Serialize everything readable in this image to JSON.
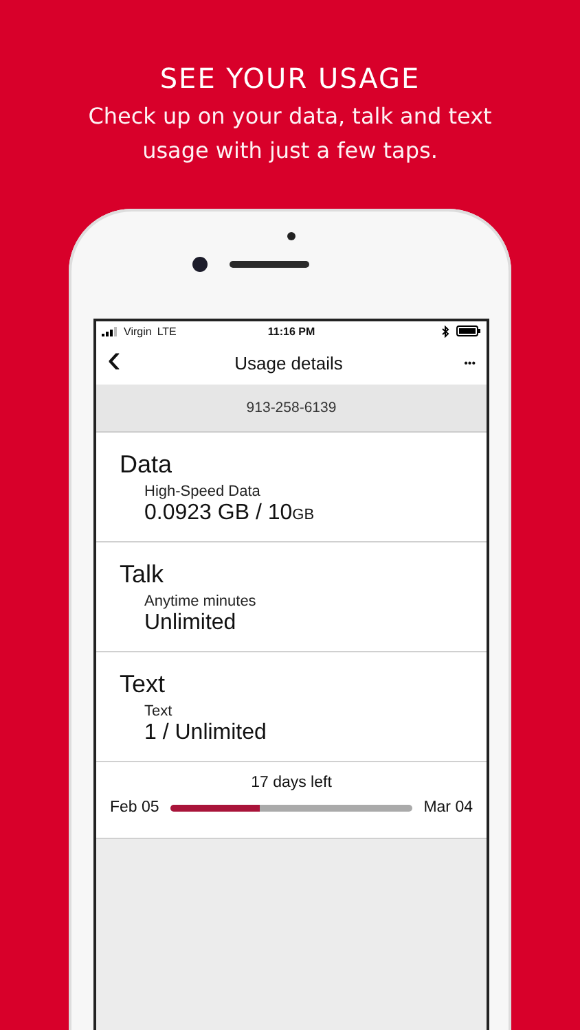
{
  "headline": "SEE YOUR USAGE",
  "subtitle": "Check up on your data, talk and text usage with just a few taps.",
  "status_bar": {
    "carrier": "Virgin",
    "network": "LTE",
    "time": "11:16 PM"
  },
  "nav": {
    "back": "‹",
    "title": "Usage details",
    "more": "•••"
  },
  "phone_number": "913-258-6139",
  "sections": [
    {
      "title": "Data",
      "label": "High-Speed Data",
      "value": "0.0923 GB / 10",
      "unit": "GB"
    },
    {
      "title": "Talk",
      "label": "Anytime minutes",
      "value": "Unlimited"
    },
    {
      "title": "Text",
      "label": "Text",
      "value": "1  / Unlimited"
    }
  ],
  "cycle": {
    "days_left": "17 days left",
    "start": "Feb 05",
    "end": "Mar 04",
    "level": 0.37
  }
}
